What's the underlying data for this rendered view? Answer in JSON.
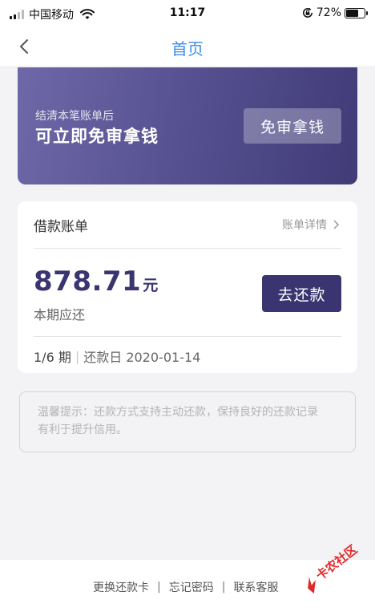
{
  "status_bar": {
    "carrier": "中国移动",
    "time": "11:17",
    "battery_percent": "72%",
    "battery_level": 0.72,
    "icons": [
      "signal-icon",
      "wifi-icon",
      "rotation-lock-icon",
      "battery-icon"
    ]
  },
  "nav": {
    "title": "首页",
    "back_icon": "chevron-left-icon"
  },
  "promo": {
    "subtitle": "结清本笔账单后",
    "headline": "可立即免审拿钱",
    "button_label": "免审拿钱",
    "gradient_start": "#6f68a8",
    "gradient_end": "#413b78"
  },
  "bill": {
    "title": "借款账单",
    "detail_link": "账单详情",
    "amount": "878.71",
    "amount_unit": "元",
    "due_label": "本期应还",
    "repay_button": "去还款",
    "period": "1/6 期",
    "separator": "|",
    "repay_date": "还款日 2020-01-14",
    "accent_color": "#3a3570"
  },
  "tip": {
    "text_line1": "温馨提示：还款方式支持主动还款，保持良好的还款记录",
    "text_line2": "有利于提升信用。"
  },
  "footer": {
    "link_change_card": "更换还款卡",
    "link_forgot_password": "忘记密码",
    "link_contact_service": "联系客服",
    "separator": "|"
  },
  "watermark": {
    "text": "卡农社区"
  }
}
